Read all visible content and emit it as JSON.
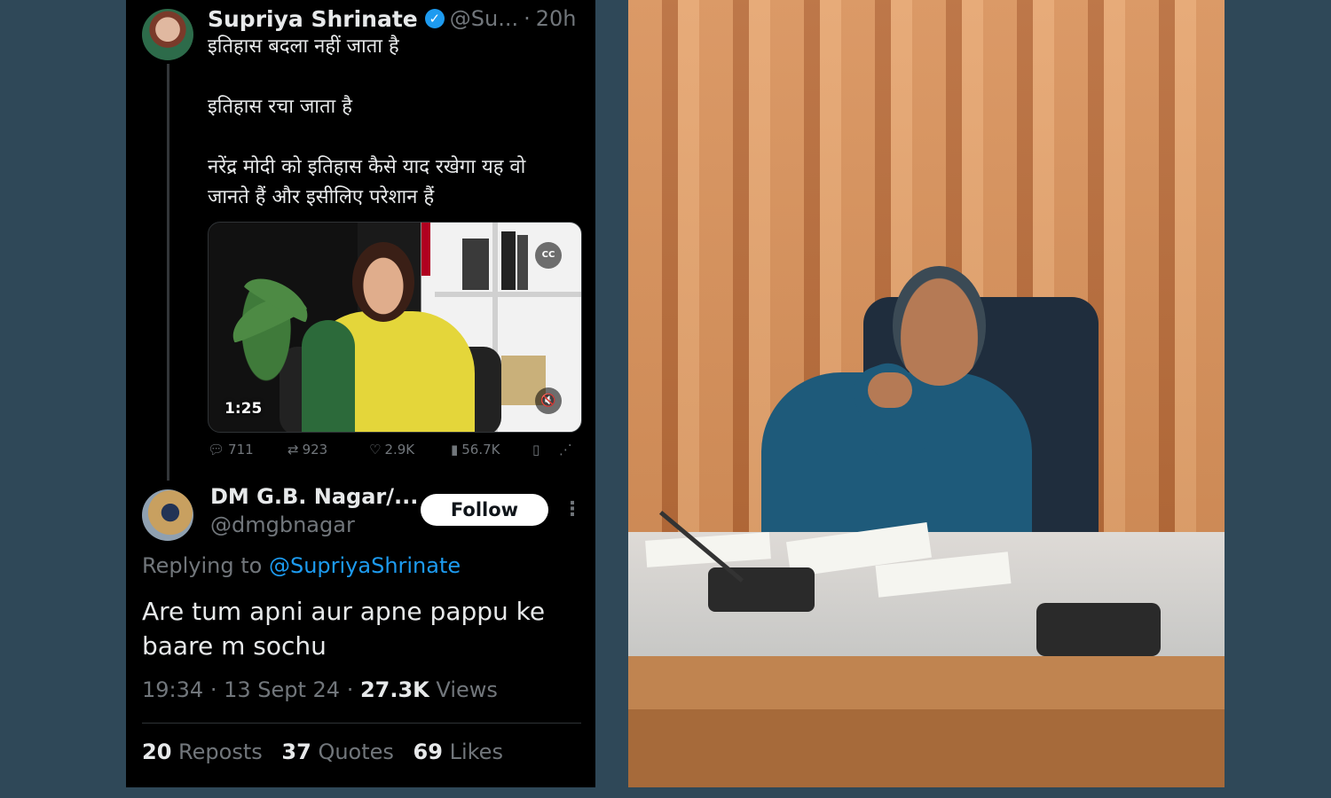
{
  "tweet1": {
    "author_name": "Supriya Shrinate",
    "handle": "@Su...",
    "separator": "·",
    "time": "20h",
    "lines": [
      "इतिहास बदला नहीं जाता है",
      "इतिहास रचा जाता है",
      "नरेंद्र मोदी को इतिहास कैसे याद रखेगा यह वो",
      "जानते हैं और इसीलिए परेशान हैं"
    ],
    "video": {
      "duration": "1:25",
      "cc_label": "CC"
    },
    "actions": {
      "replies": "711",
      "reposts": "923",
      "likes": "2.9K",
      "views": "56.7K"
    }
  },
  "tweet2": {
    "author_name": "DM G.B. Nagar/...",
    "handle": "@dmgbnagar",
    "follow_label": "Follow",
    "replying_prefix": "Replying to",
    "replying_to": "@SupriyaShrinate",
    "text": "Are tum apni aur apne pappu ke baare m sochu",
    "time": "19:34",
    "date": "13 Sept 24",
    "views_count": "27.3K",
    "views_label": "Views",
    "stats": {
      "reposts_count": "20",
      "reposts_label": "Reposts",
      "quotes_count": "37",
      "quotes_label": "Quotes",
      "likes_count": "69",
      "likes_label": "Likes"
    }
  },
  "colors": {
    "background": "#2f4858",
    "tweet_bg": "#000000",
    "text_primary": "#e7e9ea",
    "text_muted": "#71767b",
    "link": "#1d9bf0",
    "follow_bg": "#ffffff"
  },
  "icons": [
    "verified-badge-icon",
    "more-options-icon",
    "reply-icon",
    "repost-icon",
    "like-icon",
    "views-icon",
    "bookmark-icon",
    "share-icon",
    "cc-icon",
    "volume-muted-icon"
  ]
}
